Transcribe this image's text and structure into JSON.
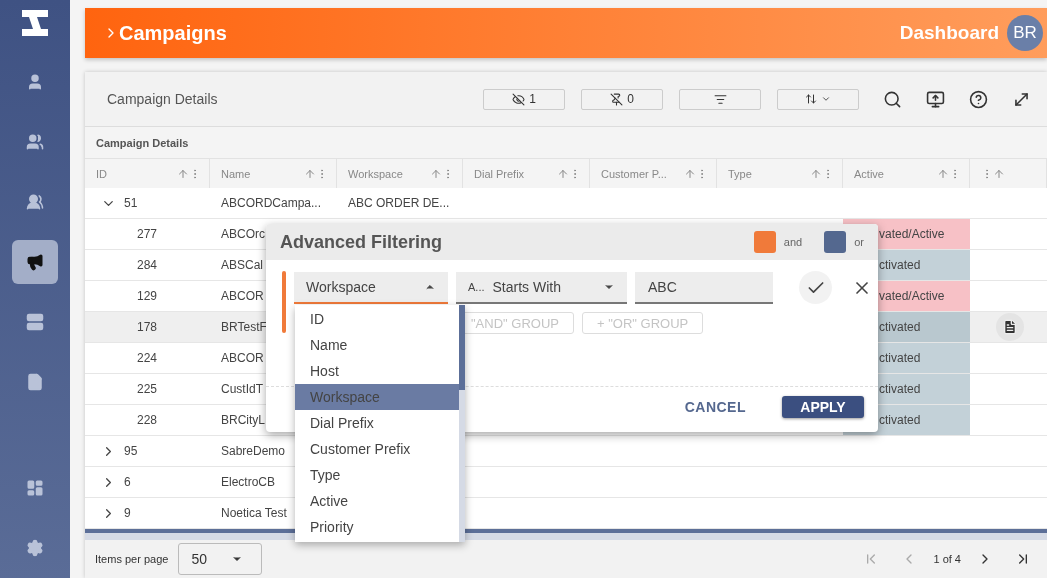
{
  "sidebar": {
    "items": [
      {
        "selected": false
      },
      {
        "selected": false
      },
      {
        "selected": false
      },
      {
        "selected": true
      },
      {
        "selected": false
      },
      {
        "selected": false
      },
      {
        "selected": false
      },
      {
        "selected": false
      }
    ]
  },
  "header": {
    "title": "Campaigns",
    "link": "Dashboard",
    "avatar": "BR"
  },
  "toolbar": {
    "title": "Campaign Details",
    "hidden_count": "1",
    "pinned_count": "0"
  },
  "table": {
    "group_label": "Campaign Details",
    "columns": [
      "ID",
      "Name",
      "Workspace",
      "Dial Prefix",
      "Customer P...",
      "Type",
      "Active"
    ],
    "rows": [
      {
        "id": "51",
        "name": "ABCORDCampa...",
        "workspace": "ABC ORDER DE...",
        "expanded": true,
        "selected": false,
        "children": [
          {
            "id": "277",
            "name": "ABCOrc",
            "active": "vated/Active",
            "color": "#f7c1c6",
            "selected": false
          },
          {
            "id": "284",
            "name": "ABSCal",
            "active": "ctivated",
            "color": "#c3d1d8",
            "selected": false
          },
          {
            "id": "129",
            "name": "ABCOR",
            "active": "vated/Active",
            "color": "#f7c1c6",
            "selected": false
          },
          {
            "id": "178",
            "name": "BRTestF",
            "active": "ctivated",
            "color": "#b9c8cf",
            "selected": true
          },
          {
            "id": "224",
            "name": "ABCOR",
            "active": "ctivated",
            "color": "#c3d1d8",
            "selected": false
          },
          {
            "id": "225",
            "name": "CustIdT",
            "active": "ctivated",
            "color": "#c3d1d8",
            "selected": false
          },
          {
            "id": "228",
            "name": "BRCityL",
            "active": "ctivated",
            "color": "#c3d1d8",
            "selected": false
          }
        ]
      },
      {
        "id": "95",
        "name": "SabreDemo",
        "expanded": false,
        "selected": false
      },
      {
        "id": "6",
        "name": "ElectroCB",
        "expanded": false,
        "selected": false
      },
      {
        "id": "9",
        "name": "Noetica Test",
        "expanded": false,
        "selected": false
      }
    ]
  },
  "dialog": {
    "title": "Advanced Filtering",
    "legend": [
      {
        "label": "and",
        "color": "#f07a3a"
      },
      {
        "label": "or",
        "color": "#54688f"
      }
    ],
    "field": {
      "value": "Workspace",
      "expanded": true
    },
    "operator": {
      "prefix": "A...",
      "value": "Starts With"
    },
    "value": "ABC",
    "group_buttons": [
      "\"AND\" GROUP",
      "+ \"OR\" GROUP"
    ],
    "cancel": "CANCEL",
    "apply": "APPLY"
  },
  "dropdown": {
    "options": [
      {
        "label": "ID",
        "selected": false
      },
      {
        "label": "Name",
        "selected": false
      },
      {
        "label": "Host",
        "selected": false
      },
      {
        "label": "Workspace",
        "selected": true
      },
      {
        "label": "Dial Prefix",
        "selected": false
      },
      {
        "label": "Customer Prefix",
        "selected": false
      },
      {
        "label": "Type",
        "selected": false
      },
      {
        "label": "Active",
        "selected": false
      },
      {
        "label": "Priority",
        "selected": false
      }
    ]
  },
  "footer": {
    "label": "Items per page",
    "page_size": "50",
    "page": "1 of 4"
  }
}
